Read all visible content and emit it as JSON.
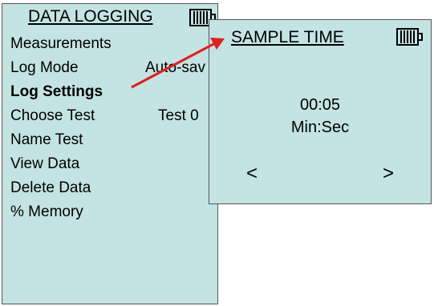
{
  "main": {
    "title": "DATA LOGGING",
    "menu": [
      {
        "label": "Measurements",
        "value": ""
      },
      {
        "label": "Log Mode",
        "value": "Auto-sav"
      },
      {
        "label": "Log Settings",
        "value": ""
      },
      {
        "label": "Choose Test",
        "value": "Test 0"
      },
      {
        "label": "Name Test",
        "value": ""
      },
      {
        "label": "View Data",
        "value": ""
      },
      {
        "label": "Delete Data",
        "value": ""
      },
      {
        "label": "% Memory",
        "value": ""
      }
    ]
  },
  "popup": {
    "title": "SAMPLE TIME",
    "time_value": "00:05",
    "time_unit": "Min:Sec",
    "prev_label": "<",
    "next_label": ">"
  },
  "colors": {
    "screen_bg": "#c4e3e3",
    "arrow": "#e02020"
  },
  "icons": {
    "battery": "battery-icon",
    "arrow": "arrow-icon"
  }
}
